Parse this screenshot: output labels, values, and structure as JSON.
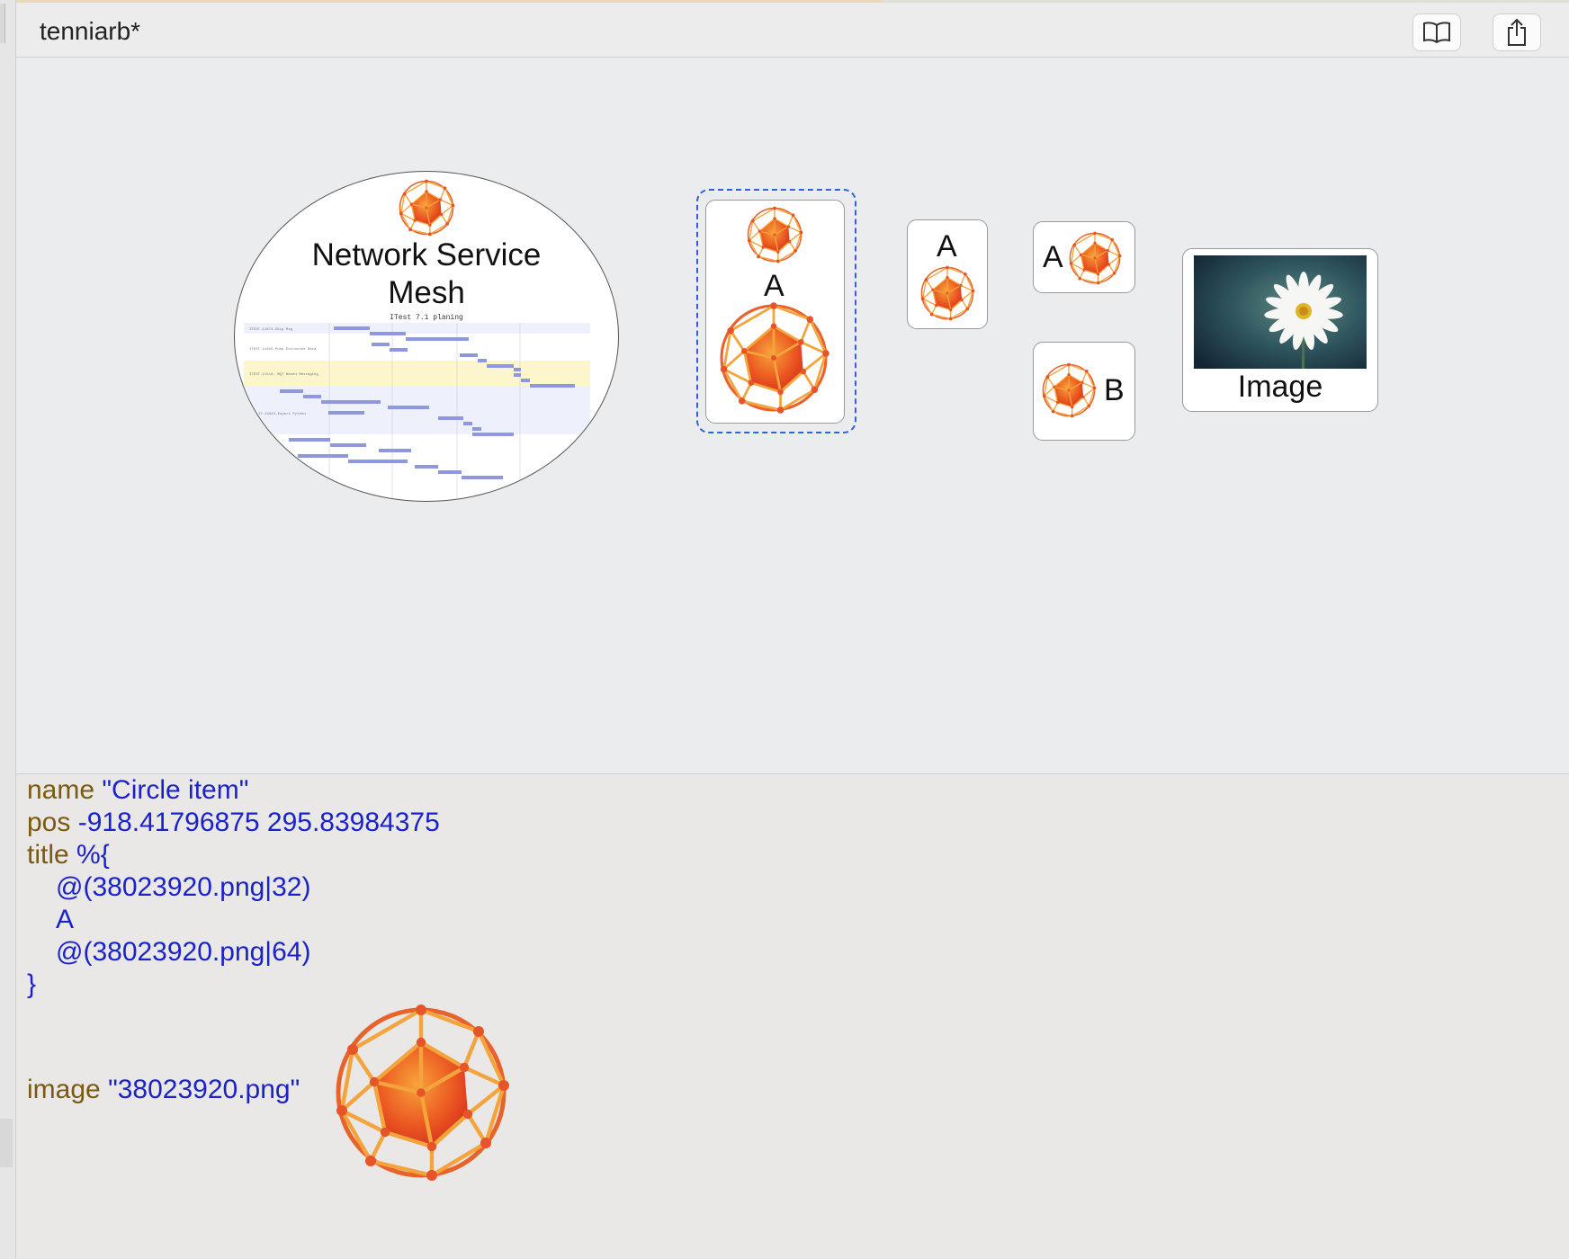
{
  "window": {
    "title": "tenniarb*",
    "toolbar": [
      {
        "name": "book-button",
        "icon": "book-icon"
      },
      {
        "name": "share-button",
        "icon": "share-icon"
      }
    ]
  },
  "canvas": {
    "oval_item": {
      "title": "Network Service Mesh",
      "title_line1": "Network Service",
      "title_line2": "Mesh",
      "embedded_chart_title": "ITest 7.1 planing"
    },
    "selected_item": {
      "label": "A"
    },
    "item_a_top": {
      "label": "A"
    },
    "item_a_right": {
      "label": "A"
    },
    "item_b": {
      "label": "B"
    },
    "image_item": {
      "label": "Image"
    }
  },
  "inspector": {
    "name_key": "name",
    "name_value": "\"Circle item\"",
    "pos_key": "pos",
    "pos_value": "-918.41796875 295.83984375",
    "title_key": "title",
    "title_open": "%{",
    "title_line1": "@(38023920.png|32)",
    "title_line2": "A",
    "title_line3": "@(38023920.png|64)",
    "title_close": "}",
    "image_key": "image",
    "image_value": "\"38023920.png\""
  },
  "colors": {
    "keyword": "#7a5a10",
    "value": "#1a22c8",
    "selection": "#2d62d8"
  }
}
